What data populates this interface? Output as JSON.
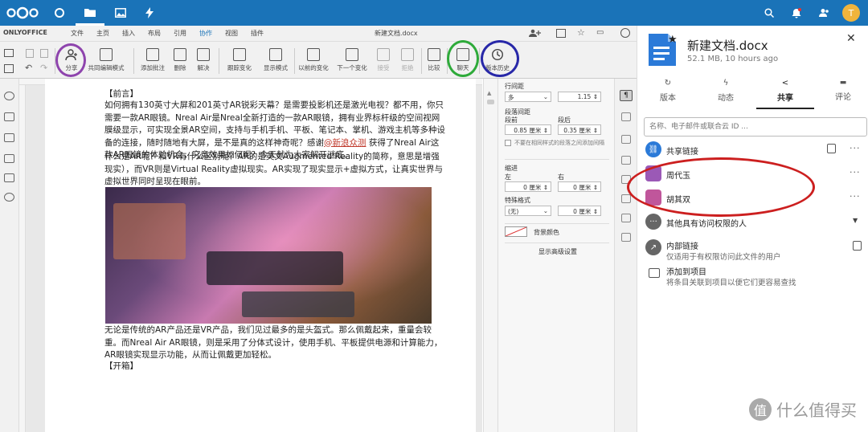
{
  "colors": {
    "topbar": "#1a73b8",
    "accent": "#1a73b8",
    "circle_purple": "#8e44ad",
    "circle_green": "#2eaa3a",
    "circle_blue": "#2828a8",
    "circle_red": "#cc1f1f"
  },
  "topbar": {
    "apps": [
      "home-icon",
      "files-icon",
      "photos-icon",
      "activity-icon"
    ],
    "user_initial": "T"
  },
  "editor": {
    "brand": "ONLYOFFICE",
    "doc_title": "新建文档.docx",
    "menu": [
      "文件",
      "主页",
      "插入",
      "布局",
      "引用",
      "协作",
      "视图",
      "插件"
    ],
    "active_menu": "协作",
    "toolbar": {
      "share": "分享",
      "co_edit": "共同编辑模式",
      "add_comment": "添加批注",
      "delete": "删除",
      "resolve": "解决",
      "track_changes": "跟踪变化",
      "display_mode": "显示模式",
      "prev_change": "以前的变化",
      "next_change": "下一个变化",
      "accept": "接受",
      "reject": "拒绝",
      "compare": "比较",
      "chat": "聊天",
      "version_history": "版本历史"
    }
  },
  "document": {
    "heading1": "【前言】",
    "para1": "如何拥有130英寸大屏和201英寸AR锐彩天幕？是需要投影机还是激光电视？都不用，你只需要一款AR眼镜。Nreal Air是Nreal全新打造的一款AR眼镜，拥有业界标杆级的空间视网膜级显示，可实现全景AR空间，支持与手机手机、平板、笔记本、掌机、游戏主机等多种设备的连接，随时随地有大屏，是不是真的这样神奇呢？感谢",
    "para1_link": "@新浪众测",
    "para1_tail": " 获得了Nreal Air这款AR眼镜的体验机会，究竟效果如何呢？今天就为大家解开谜底。",
    "para2": "什么是AR呢？和VR有什么区别呢？AR的是英文Augmented Reality的简称，意思是增强现实），而VR则是Virtual Reality虚拟现实。AR实现了现实显示+虚拟方式，让真实世界与虚拟世界同时呈现在眼前。",
    "para3": "无论是传统的AR产品还是VR产品，我们见过最多的是头盔式。那么佩戴起来，重量会较重。而Nreal Air AR眼镜，则是采用了分体式设计，使用手机、平板提供电源和计算能力，AR眼镜实现显示功能，从而让佩戴更加轻松。",
    "heading2": "【开箱】"
  },
  "para_settings": {
    "line_spacing_label": "行间距",
    "line_spacing_mode": "多",
    "line_spacing_value": "1.15",
    "para_spacing_label": "段落间距",
    "before_label": "段前",
    "after_label": "段后",
    "before_value": "0.85 厘米",
    "after_value": "0.35 厘米",
    "no_space_label": "不要在相同样式的段落之间添加间隔",
    "indent_label": "缩进",
    "left_label": "左",
    "right_label": "右",
    "left_value": "0 厘米",
    "right_value": "0 厘米",
    "special_label": "特殊格式",
    "special_value": "(无)",
    "special_amount": "0 厘米",
    "bg_color_label": "背景颜色",
    "advanced_label": "显示高级设置"
  },
  "sidebar": {
    "file_name": "新建文档.docx",
    "file_meta": "52.1 MB, 10 hours ago",
    "tabs": [
      "版本",
      "动态",
      "共享",
      "评论"
    ],
    "active_tab": "共享",
    "search_placeholder": "名称、电子邮件或联合云 ID ...",
    "share_link": "共享链接",
    "users": [
      "周代玉",
      "胡其双"
    ],
    "others_with_access": "其他具有访问权限的人",
    "internal_link": "内部链接",
    "internal_link_desc": "仅适用于有权限访问此文件的用户",
    "add_project": "添加到项目",
    "add_project_desc": "将条目关联到项目以便它们更容易查找"
  },
  "watermark": {
    "text": "什么值得买",
    "icon_char": "值"
  }
}
